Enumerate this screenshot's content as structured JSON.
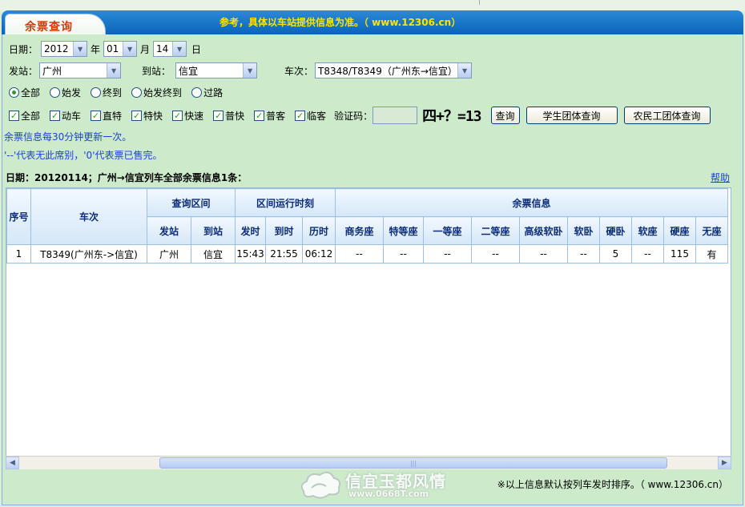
{
  "header": {
    "tab_label": "余票查询",
    "notice": "参考，具体以车站提供信息为准。（ www.12306.cn）"
  },
  "form": {
    "date_label": "日期：",
    "year_value": "2012",
    "year_label": "年",
    "month_value": "01",
    "month_label": "月",
    "day_value": "14",
    "day_label": "日",
    "from_label": "发站：",
    "from_value": "广州",
    "to_label": "到站：",
    "to_value": "信宜",
    "train_label": "车次：",
    "train_value": "T8348/T8349（广州东→信宜）",
    "radios": [
      {
        "label": "全部",
        "checked": true
      },
      {
        "label": "始发",
        "checked": false
      },
      {
        "label": "终到",
        "checked": false
      },
      {
        "label": "始发终到",
        "checked": false
      },
      {
        "label": "过路",
        "checked": false
      }
    ],
    "checkboxes": [
      {
        "label": "全部",
        "checked": true
      },
      {
        "label": "动车",
        "checked": true
      },
      {
        "label": "直特",
        "checked": true
      },
      {
        "label": "特快",
        "checked": true
      },
      {
        "label": "快速",
        "checked": true
      },
      {
        "label": "普快",
        "checked": true
      },
      {
        "label": "普客",
        "checked": true
      },
      {
        "label": "临客",
        "checked": true
      }
    ],
    "vcode_label": "验证码：",
    "captcha_text": "四+？=13",
    "query_button": "查询",
    "student_button": "学生团体查询",
    "worker_button": "农民工团体查询"
  },
  "info": {
    "update_note": "余票信息每30分钟更新一次。",
    "legend_note": "'--'代表无此席别，'0'代表票已售完。"
  },
  "result": {
    "title": "日期：20120114；广州→信宜列车全部余票信息1条：",
    "help": "帮助"
  },
  "table": {
    "col_seq": "序号",
    "col_train": "车次",
    "group_interval": "查询区间",
    "group_time": "区间运行时刻",
    "group_tickets": "余票信息",
    "sub_headers": [
      "发站",
      "到站",
      "发时",
      "到时",
      "历时",
      "商务座",
      "特等座",
      "一等座",
      "二等座",
      "高级软卧",
      "软卧",
      "硬卧",
      "软座",
      "硬座",
      "无座"
    ],
    "rows": [
      [
        "1",
        "T8349(广州东->信宜)",
        "广州",
        "信宜",
        "15:43",
        "21:55",
        "06:12",
        "--",
        "--",
        "--",
        "--",
        "--",
        "--",
        "5",
        "--",
        "115",
        "有"
      ]
    ]
  },
  "footer": {
    "note": "※以上信息默认按列车发时排序。（ www.12306.cn）"
  },
  "watermark": {
    "text": "信宜玉都风情",
    "url": "www.0668T.com"
  }
}
